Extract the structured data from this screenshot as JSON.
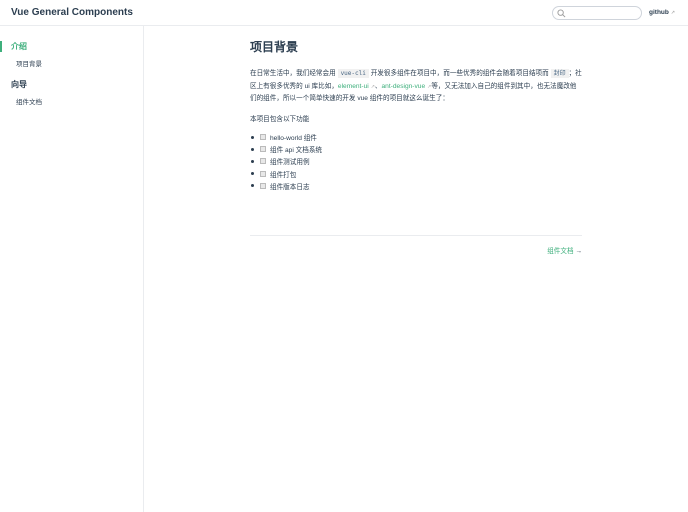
{
  "header": {
    "title": "Vue General Components",
    "search_placeholder": "",
    "github_label": "github"
  },
  "sidebar": {
    "groups": [
      {
        "label": "介绍",
        "items": [
          "项目背景"
        ]
      },
      {
        "label": "向导",
        "items": [
          "组件文档"
        ]
      }
    ]
  },
  "main": {
    "title": "项目背景",
    "para": {
      "t1": "在日常生活中，我们经常会用 ",
      "code1": "vue-cli",
      "t2": " 开发很多组件在项目中，而一些优秀的组件会随着项目结项而 ",
      "code2": "封印",
      "t3": "；社区上有很多优秀的 ui 库比如，",
      "link1": "element-ui",
      "t4": "、",
      "link2": "ant-design-vue",
      "t5": "等，又无法加入自己的组件到其中，也无法魔改他们的组件，所以一个简单快速的开发 vue 组件的项目就这么诞生了："
    },
    "features_intro": "本项目包含以下功能",
    "features": [
      "hello-world 组件",
      "组件 api 文档系统",
      "组件测试用例",
      "组件打包",
      "组件版本日志"
    ],
    "next_label": "组件文档",
    "next_arrow": "→"
  },
  "colors": {
    "accent": "#3eaf7c",
    "text": "#2c3e50"
  }
}
